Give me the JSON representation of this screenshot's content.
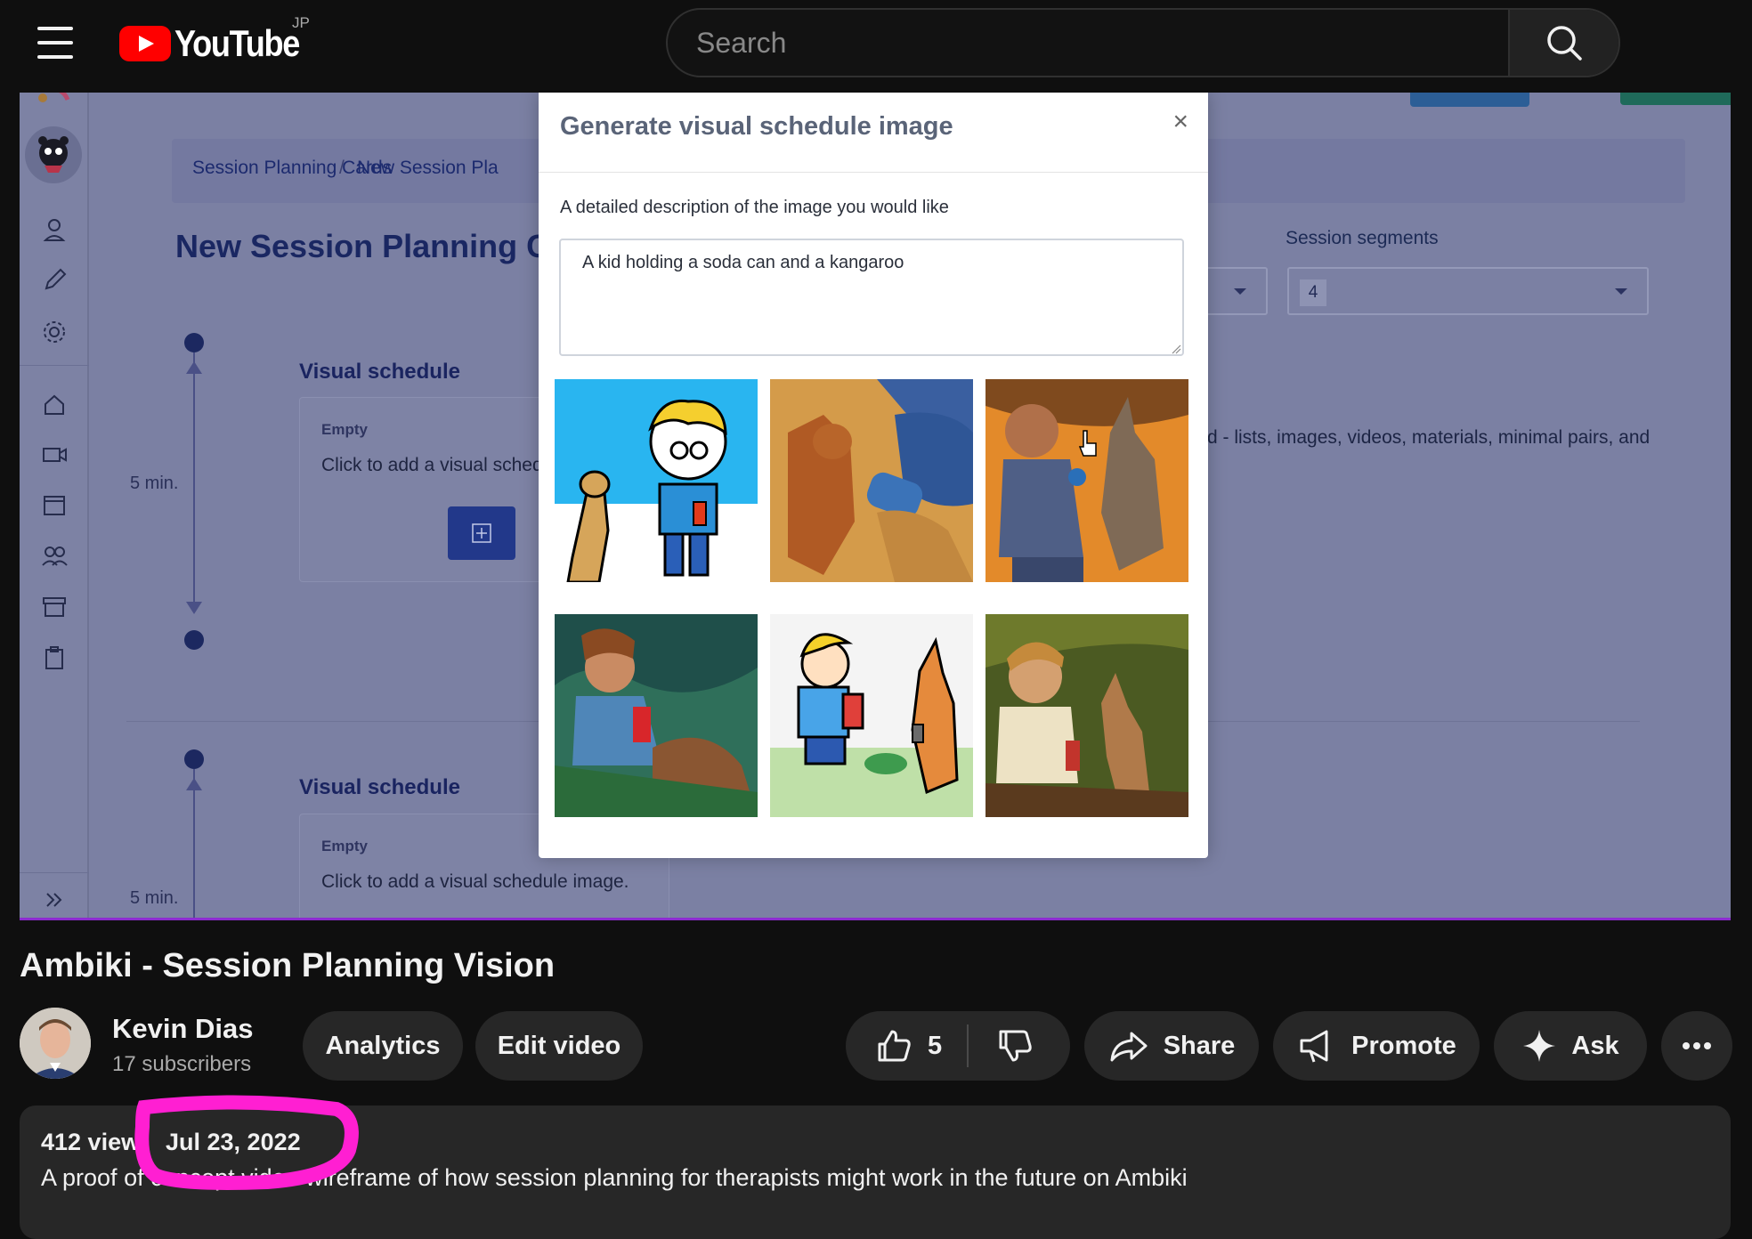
{
  "header": {
    "logo_text": "YouTube",
    "region": "JP",
    "search_placeholder": "Search"
  },
  "app": {
    "breadcrumb": [
      "Session Planning Cards",
      "New Session Pla"
    ],
    "page_title": "New Session Planning Card",
    "session_segments_label": "Session segments",
    "session_segments_value": "4",
    "side_text": "d - lists, images, videos, materials, minimal pairs, and",
    "timeline_duration": "5 min.",
    "visual_schedule_title": "Visual schedule",
    "empty_label": "Empty",
    "card1_click_text": "Click to add a visual schedul",
    "card2_click_text": "Click to add a visual schedule image."
  },
  "modal": {
    "title": "Generate visual schedule image",
    "close_label": "×",
    "description_label": "A detailed description of the image you would like",
    "prompt_value": "A kid holding a soda can and a kangaroo"
  },
  "video": {
    "title": "Ambiki - Session Planning Vision",
    "channel": "Kevin Dias",
    "subscribers": "17 subscribers",
    "analytics_label": "Analytics",
    "edit_label": "Edit video",
    "likes": "5",
    "share_label": "Share",
    "promote_label": "Promote",
    "ask_label": "Ask",
    "views": "412 view",
    "date": "Jul 23, 2022",
    "description": "A proof of concept video wireframe of how session planning for therapists might work in the future on Ambiki"
  },
  "colors": {
    "youtube_red": "#ff0000",
    "annotation_magenta": "#ff1fd2",
    "app_overlay": "#7b80a3"
  }
}
